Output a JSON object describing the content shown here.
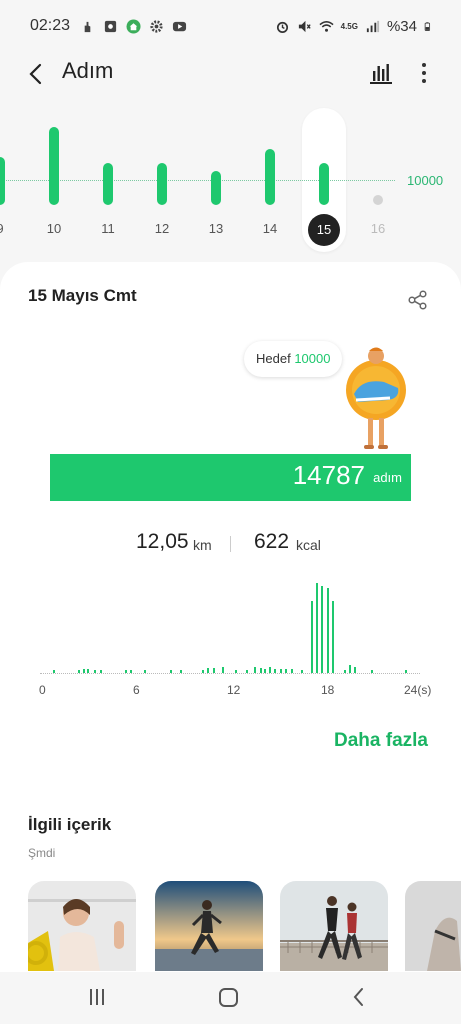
{
  "status_bar": {
    "time": "02:23",
    "battery": "%34",
    "left_icons": [
      "silent-hand-icon",
      "gallery-icon",
      "home-app-icon",
      "settings-gear-icon",
      "youtube-icon"
    ],
    "right_icons": [
      "alarm-icon",
      "mute-icon",
      "wifi-icon",
      "4g-signal-icon",
      "battery-icon"
    ],
    "network_label": "4.5G"
  },
  "app_bar": {
    "title": "Adım",
    "back_icon": "chevron-left-icon",
    "chart_icon": "bar-chart-icon",
    "more_icon": "more-vertical-icon"
  },
  "day_strip": {
    "goal_label": "10000",
    "days": [
      {
        "label": "9",
        "value": 9800
      },
      {
        "label": "10",
        "value": 16000
      },
      {
        "label": "11",
        "value": 8600
      },
      {
        "label": "12",
        "value": 8500
      },
      {
        "label": "13",
        "value": 7000
      },
      {
        "label": "14",
        "value": 11400
      },
      {
        "label": "15",
        "value": 8500,
        "selected": true
      },
      {
        "label": "16",
        "value": 0,
        "future": true
      }
    ]
  },
  "summary": {
    "date": "15 Mayıs Cmt",
    "goal_text": "Hedef",
    "goal_value": "10000",
    "steps_value": "14787",
    "steps_unit": "adım",
    "distance_value": "12,05",
    "distance_unit": "km",
    "calories_value": "622",
    "calories_unit": "kcal",
    "more_label": "Daha fazla"
  },
  "hourly_chart": {
    "x_labels": [
      "0",
      "6",
      "12",
      "18",
      "24(s)"
    ],
    "accent": "#1ec86e"
  },
  "chart_data": {
    "type": "bar",
    "title": "",
    "xlabel": "",
    "ylabel": "",
    "x_range": [
      0,
      24
    ],
    "bars": [
      {
        "x": 0.7,
        "v": 3
      },
      {
        "x": 2.3,
        "v": 3
      },
      {
        "x": 2.6,
        "v": 4
      },
      {
        "x": 2.9,
        "v": 4
      },
      {
        "x": 3.3,
        "v": 3
      },
      {
        "x": 3.7,
        "v": 3
      },
      {
        "x": 5.3,
        "v": 3
      },
      {
        "x": 5.6,
        "v": 3
      },
      {
        "x": 6.5,
        "v": 3
      },
      {
        "x": 8.2,
        "v": 3
      },
      {
        "x": 8.8,
        "v": 3
      },
      {
        "x": 10.2,
        "v": 3
      },
      {
        "x": 10.5,
        "v": 5
      },
      {
        "x": 10.9,
        "v": 5
      },
      {
        "x": 11.5,
        "v": 6
      },
      {
        "x": 12.3,
        "v": 3
      },
      {
        "x": 13.0,
        "v": 3
      },
      {
        "x": 13.5,
        "v": 6
      },
      {
        "x": 13.9,
        "v": 5
      },
      {
        "x": 14.2,
        "v": 4
      },
      {
        "x": 14.5,
        "v": 6
      },
      {
        "x": 14.8,
        "v": 4
      },
      {
        "x": 15.2,
        "v": 4
      },
      {
        "x": 15.5,
        "v": 4
      },
      {
        "x": 15.9,
        "v": 4
      },
      {
        "x": 16.5,
        "v": 3
      },
      {
        "x": 17.2,
        "v": 72
      },
      {
        "x": 17.5,
        "v": 90
      },
      {
        "x": 17.8,
        "v": 87
      },
      {
        "x": 18.2,
        "v": 85
      },
      {
        "x": 18.5,
        "v": 72
      },
      {
        "x": 19.3,
        "v": 3
      },
      {
        "x": 19.6,
        "v": 8
      },
      {
        "x": 19.9,
        "v": 6
      },
      {
        "x": 21.0,
        "v": 3
      },
      {
        "x": 23.2,
        "v": 3
      }
    ]
  },
  "related": {
    "title": "İlgili içerik",
    "subtitle": "Şmdi"
  },
  "nav": {
    "recent_icon": "recent-apps-icon",
    "home_icon": "home-icon",
    "back_icon": "back-arrow-icon"
  }
}
